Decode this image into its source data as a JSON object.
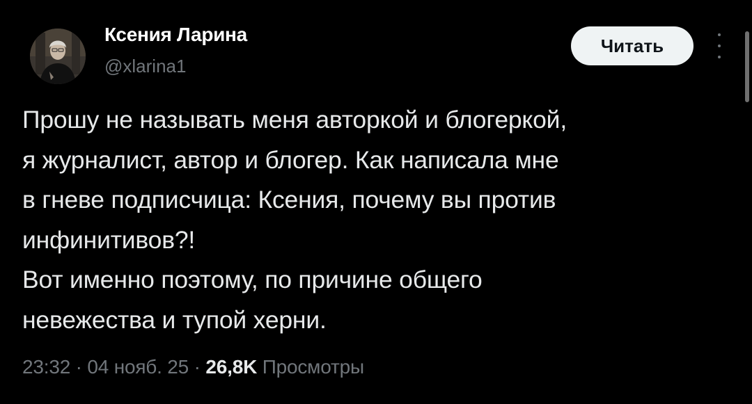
{
  "author": {
    "display_name": "Ксения Ларина",
    "handle": "@xlarina1"
  },
  "follow_button": {
    "label": "Читать"
  },
  "tweet": {
    "lines": [
      "Прошу не называть меня авторкой и блогеркой,",
      "я журналист, автор и блогер. Как написала мне",
      "в гневе подписчица: Ксения, почему вы против",
      "инфинитивов?!",
      "Вот именно поэтому, по причине общего",
      "невежества и тупой херни."
    ]
  },
  "meta": {
    "time": "23:32",
    "separator": "·",
    "date": "04 нояб. 25",
    "views_count": "26,8K",
    "views_label": "Просмотры"
  },
  "icons": {
    "more": "more-vertical-icon",
    "avatar": "avatar-photo"
  },
  "colors": {
    "background": "#000000",
    "text_primary": "#e7e9ea",
    "text_secondary": "#71767b",
    "button_bg": "#eff3f4",
    "button_text": "#0f1419"
  }
}
